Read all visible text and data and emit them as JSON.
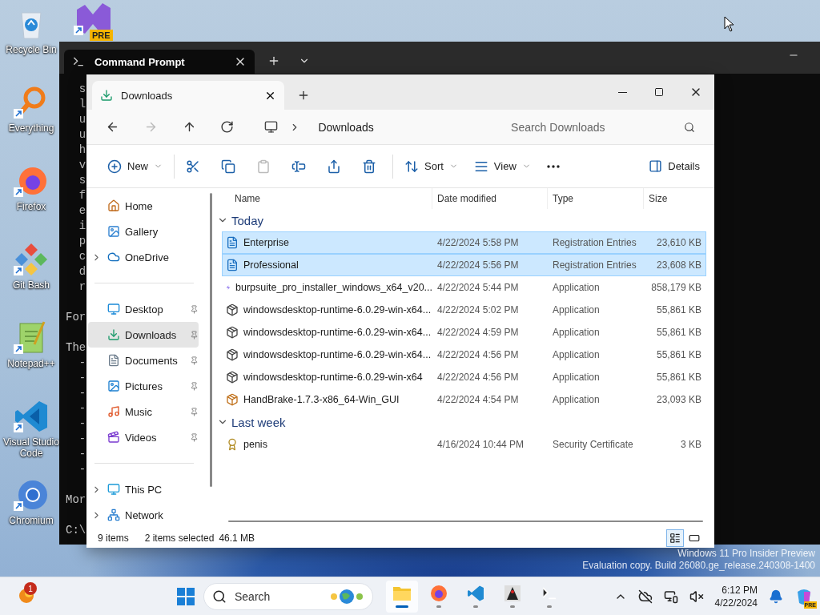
{
  "desktop_icons": [
    {
      "kind": "recycle",
      "label": "Recycle Bin"
    },
    {
      "kind": "everything",
      "label": "Everything"
    },
    {
      "kind": "firefox",
      "label": "Firefox"
    },
    {
      "kind": "gitbash",
      "label": "Git Bash"
    },
    {
      "kind": "notepad",
      "label": "Notepad++"
    },
    {
      "kind": "vscode",
      "label": "Visual Studio Code"
    },
    {
      "kind": "chromium",
      "label": "Chromium"
    }
  ],
  "partial_desktop_icon": {
    "badge": "PRE"
  },
  "terminal": {
    "tab_title": "Command Prompt",
    "blocks": [
      [
        "  s",
        "  l",
        "  u",
        "  u",
        "  h",
        "  v",
        "  s",
        "  f",
        "  e",
        "  i",
        "  p",
        "  c",
        "  d",
        "  r"
      ],
      [
        "For"
      ],
      [
        "The",
        "  -",
        "  -",
        "  -",
        "  -",
        "  -",
        "  -",
        "  -",
        "  -"
      ],
      [
        "Mor"
      ],
      [
        "C:\\"
      ]
    ]
  },
  "explorer": {
    "tab_title": "Downloads",
    "nav_buttons": [
      {
        "kind": "back",
        "disabled": false
      },
      {
        "kind": "forward",
        "disabled": true
      },
      {
        "kind": "up",
        "disabled": false
      },
      {
        "kind": "refresh",
        "disabled": false
      }
    ],
    "address": "Downloads",
    "search_placeholder": "Search Downloads",
    "toolbar_groups": [
      [
        {
          "kind": "new",
          "label": "New",
          "menu": true,
          "disabled": false
        }
      ],
      [
        {
          "kind": "cut",
          "disabled": false
        },
        {
          "kind": "copy",
          "disabled": false
        },
        {
          "kind": "paste",
          "disabled": true
        },
        {
          "kind": "rename",
          "disabled": false
        },
        {
          "kind": "share",
          "disabled": false
        },
        {
          "kind": "delete",
          "disabled": false
        }
      ],
      [
        {
          "kind": "sort",
          "label": "Sort",
          "menu": true,
          "disabled": false
        },
        {
          "kind": "view",
          "label": "View",
          "menu": true,
          "disabled": false
        },
        {
          "kind": "more",
          "disabled": false
        }
      ]
    ],
    "details_button": "Details",
    "sidebar_sections": [
      [
        {
          "kind": "home",
          "label": "Home",
          "expandable": false,
          "pinned": false,
          "selected": false
        },
        {
          "kind": "gallery",
          "label": "Gallery",
          "expandable": false,
          "pinned": false,
          "selected": false
        },
        {
          "kind": "cloud",
          "label": "OneDrive",
          "expandable": true,
          "pinned": false,
          "selected": false
        }
      ],
      [
        {
          "kind": "desktop",
          "label": "Desktop",
          "expandable": false,
          "pinned": true,
          "selected": false
        },
        {
          "kind": "download",
          "label": "Downloads",
          "expandable": false,
          "pinned": true,
          "selected": true
        },
        {
          "kind": "documents",
          "label": "Documents",
          "expandable": false,
          "pinned": true,
          "selected": false
        },
        {
          "kind": "pictures",
          "label": "Pictures",
          "expandable": false,
          "pinned": true,
          "selected": false
        },
        {
          "kind": "music",
          "label": "Music",
          "expandable": false,
          "pinned": true,
          "selected": false
        },
        {
          "kind": "videos",
          "label": "Videos",
          "expandable": false,
          "pinned": true,
          "selected": false
        }
      ],
      [
        {
          "kind": "pc",
          "label": "This PC",
          "expandable": true,
          "pinned": false,
          "selected": false
        },
        {
          "kind": "network",
          "label": "Network",
          "expandable": true,
          "pinned": false,
          "selected": false
        }
      ]
    ],
    "columns": [
      "Name",
      "Date modified",
      "Type",
      "Size"
    ],
    "groups": [
      {
        "label": "Today",
        "expanded": true,
        "rows": [
          {
            "kind": "registry",
            "name": "Enterprise",
            "date": "4/22/2024 5:58 PM",
            "type": "Registration Entries",
            "size": "23,610 KB",
            "selected": true
          },
          {
            "kind": "registry",
            "name": "Professional",
            "date": "4/22/2024 5:56 PM",
            "type": "Registration Entries",
            "size": "23,608 KB",
            "selected": true
          },
          {
            "kind": "lightning",
            "name": "burpsuite_pro_installer_windows_x64_v20...",
            "date": "4/22/2024 5:44 PM",
            "type": "Application",
            "size": "858,179 KB",
            "selected": false
          },
          {
            "kind": "installer",
            "name": "windowsdesktop-runtime-6.0.29-win-x64...",
            "date": "4/22/2024 5:02 PM",
            "type": "Application",
            "size": "55,861 KB",
            "selected": false
          },
          {
            "kind": "installer",
            "name": "windowsdesktop-runtime-6.0.29-win-x64...",
            "date": "4/22/2024 4:59 PM",
            "type": "Application",
            "size": "55,861 KB",
            "selected": false
          },
          {
            "kind": "installer",
            "name": "windowsdesktop-runtime-6.0.29-win-x64...",
            "date": "4/22/2024 4:56 PM",
            "type": "Application",
            "size": "55,861 KB",
            "selected": false
          },
          {
            "kind": "installer",
            "name": "windowsdesktop-runtime-6.0.29-win-x64",
            "date": "4/22/2024 4:56 PM",
            "type": "Application",
            "size": "55,861 KB",
            "selected": false
          },
          {
            "kind": "handbrake",
            "name": "HandBrake-1.7.3-x86_64-Win_GUI",
            "date": "4/22/2024 4:54 PM",
            "type": "Application",
            "size": "23,093 KB",
            "selected": false
          }
        ]
      },
      {
        "label": "Last week",
        "expanded": true,
        "rows": [
          {
            "kind": "certificate",
            "name": "penis",
            "date": "4/16/2024 10:44 PM",
            "type": "Security Certificate",
            "size": "3 KB",
            "selected": false
          }
        ]
      }
    ],
    "status": {
      "count": "9 items",
      "selection": "2 items selected",
      "size": "46.1 MB"
    },
    "view_buttons": [
      {
        "kind": "details",
        "selected": true
      },
      {
        "kind": "tiles",
        "selected": false
      }
    ]
  },
  "watermark": [
    "Windows 11 Pro Insider Preview",
    "Evaluation copy. Build 26080.ge_release.240308-1400"
  ],
  "taskbar": {
    "widget_badge": "1",
    "search_placeholder": "Search",
    "apps": [
      {
        "kind": "explorer",
        "active": true
      },
      {
        "kind": "firefox",
        "active": false
      },
      {
        "kind": "vscode",
        "active": false
      },
      {
        "kind": "java",
        "active": false
      },
      {
        "kind": "terminal",
        "active": false
      }
    ],
    "time": "6:12 PM",
    "date": "4/22/2024",
    "copilot_badge": "PRE"
  }
}
